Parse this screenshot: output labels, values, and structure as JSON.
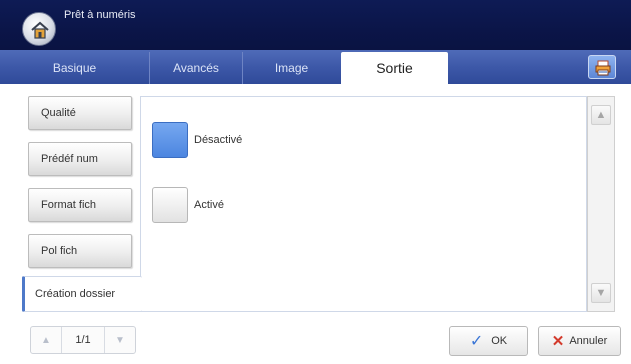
{
  "header": {
    "title": "Prêt à numéris"
  },
  "tabs": [
    {
      "label": "Basique"
    },
    {
      "label": "Avancés"
    },
    {
      "label": "Image"
    },
    {
      "label": "Sortie",
      "active": true
    }
  ],
  "sidebar": {
    "items": [
      {
        "label": "Qualité"
      },
      {
        "label": "Prédéf num"
      },
      {
        "label": "Format fich"
      },
      {
        "label": "Pol fich"
      },
      {
        "label": "Création dossier",
        "active": true
      }
    ]
  },
  "options": [
    {
      "label": "Désactivé",
      "selected": true
    },
    {
      "label": "Activé",
      "selected": false
    }
  ],
  "pager": {
    "page": "1/1"
  },
  "footer": {
    "ok_label": "OK",
    "cancel_label": "Annuler"
  },
  "colors": {
    "header_bg": "#0e1b55",
    "tab_bar": "#3d58a8",
    "selected_option": "#5a90e6",
    "cancel_icon": "#d33a2c",
    "ok_icon": "#3a75d6"
  },
  "icons": {
    "home": "home-icon",
    "printer": "printer-icon"
  }
}
